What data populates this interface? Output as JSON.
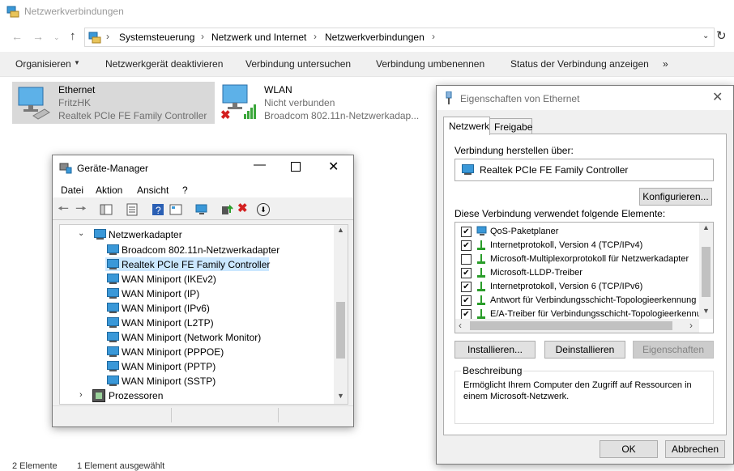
{
  "explorer": {
    "title": "Netzwerkverbindungen",
    "breadcrumb": [
      "Systemsteuerung",
      "Netzwerk und Internet",
      "Netzwerkverbindungen"
    ],
    "commands": [
      "Organisieren",
      "Netzwerkgerät deaktivieren",
      "Verbindung untersuchen",
      "Verbindung umbenennen",
      "Status der Verbindung anzeigen",
      "»"
    ],
    "adapters": [
      {
        "name": "Ethernet",
        "network": "FritzHK",
        "device": "Realtek PCIe FE Family Controller"
      },
      {
        "name": "WLAN",
        "network": "Nicht verbunden",
        "device": "Broadcom 802.11n-Netzwerkadap..."
      }
    ],
    "status_bar": [
      "2 Elemente",
      "1 Element ausgewählt"
    ]
  },
  "device_manager": {
    "title": "Geräte-Manager",
    "menu": [
      "Datei",
      "Aktion",
      "Ansicht",
      "?"
    ],
    "category": "Netzwerkadapter",
    "devices": [
      "Broadcom 802.11n-Netzwerkadapter",
      "Realtek PCIe FE Family Controller",
      "WAN Miniport (IKEv2)",
      "WAN Miniport (IP)",
      "WAN Miniport (IPv6)",
      "WAN Miniport (L2TP)",
      "WAN Miniport (Network Monitor)",
      "WAN Miniport (PPPOE)",
      "WAN Miniport (PPTP)",
      "WAN Miniport (SSTP)"
    ],
    "next_category": "Prozessoren"
  },
  "properties": {
    "title": "Eigenschaften von Ethernet",
    "tabs": [
      "Netzwerk",
      "Freigabe"
    ],
    "connect_label": "Verbindung herstellen über:",
    "adapter": "Realtek PCIe FE Family Controller",
    "configure": "Konfigurieren...",
    "items_label": "Diese Verbindung verwendet folgende Elemente:",
    "items": [
      {
        "label": "QoS-Paketplaner",
        "checked": true
      },
      {
        "label": "Internetprotokoll, Version 4 (TCP/IPv4)",
        "checked": true
      },
      {
        "label": "Microsoft-Multiplexorprotokoll für Netzwerkadapter",
        "checked": false
      },
      {
        "label": "Microsoft-LLDP-Treiber",
        "checked": true
      },
      {
        "label": "Internetprotokoll, Version 6 (TCP/IPv6)",
        "checked": true
      },
      {
        "label": "Antwort für Verbindungsschicht-Topologieerkennung",
        "checked": true
      },
      {
        "label": "E/A-Treiber für Verbindungsschicht-Topologieerkennung",
        "checked": true
      }
    ],
    "install": "Installieren...",
    "uninstall": "Deinstallieren",
    "properties_btn": "Eigenschaften",
    "description_label": "Beschreibung",
    "description": "Ermöglicht Ihrem Computer den Zugriff auf Ressourcen in einem Microsoft-Netzwerk.",
    "ok": "OK",
    "cancel": "Abbrechen"
  }
}
